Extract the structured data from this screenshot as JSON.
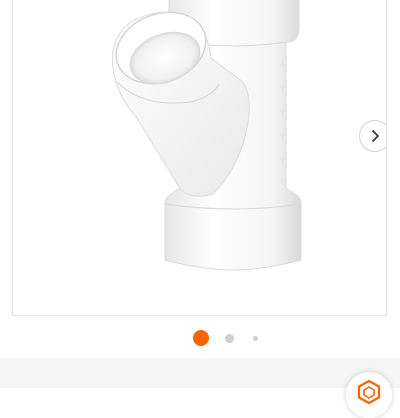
{
  "gallery": {
    "product_image_icon": "pvc-wye-fitting-icon",
    "next_icon": "chevron-right-icon",
    "slide_count": 3,
    "active_slide": 1
  },
  "colors": {
    "accent": "#f96302",
    "dot_inactive": "#cfcfcf",
    "band": "#f5f5f5",
    "border": "#e3e3e3"
  },
  "badge": {
    "icon": "hexagon-badge-icon"
  }
}
